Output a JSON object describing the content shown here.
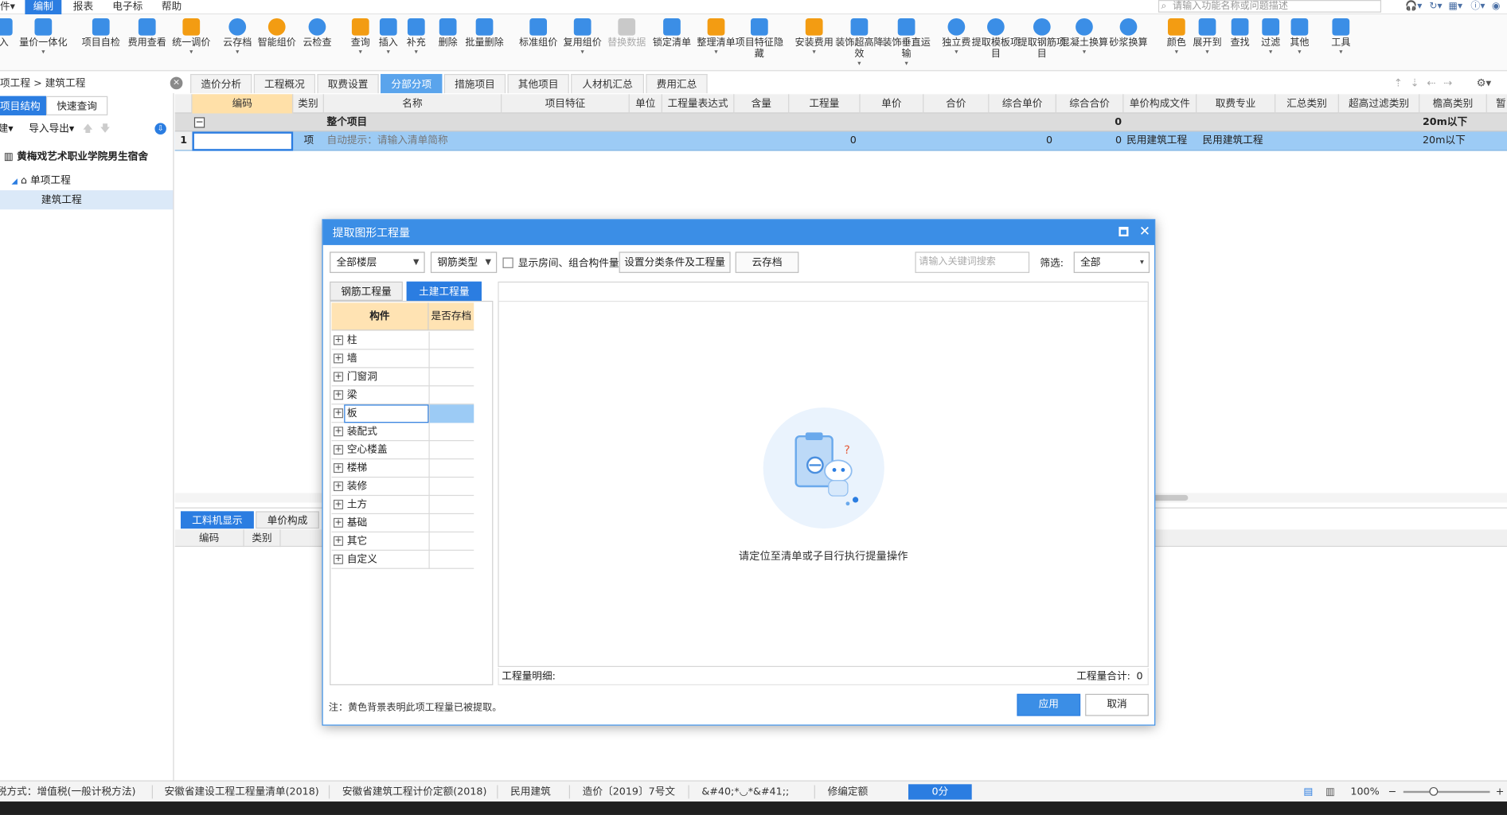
{
  "menubar": {
    "items": [
      "件▾",
      "编制",
      "报表",
      "电子标",
      "帮助"
    ],
    "search_placeholder": "请输入功能名称或问题描述"
  },
  "ribbon": {
    "buttons": [
      {
        "label": "入",
        "dd": ""
      },
      {
        "label": "量价一体化",
        "dd": "▾"
      },
      {
        "label": "项目自检",
        "dd": ""
      },
      {
        "label": "费用查看",
        "dd": ""
      },
      {
        "label": "统一调价",
        "dd": "▾"
      },
      {
        "label": "云存档",
        "dd": "▾"
      },
      {
        "label": "智能组价",
        "dd": ""
      },
      {
        "label": "云检查",
        "dd": ""
      },
      {
        "label": "查询",
        "dd": "▾"
      },
      {
        "label": "插入",
        "dd": "▾"
      },
      {
        "label": "补充",
        "dd": "▾"
      },
      {
        "label": "删除",
        "dd": ""
      },
      {
        "label": "批量删除",
        "dd": ""
      },
      {
        "label": "标准组价",
        "dd": ""
      },
      {
        "label": "复用组价",
        "dd": "▾"
      },
      {
        "label": "替换数据",
        "dd": ""
      },
      {
        "label": "锁定清单",
        "dd": ""
      },
      {
        "label": "整理清单",
        "dd": "▾"
      },
      {
        "label": "项目特征隐藏",
        "dd": ""
      },
      {
        "label": "安装费用",
        "dd": "▾"
      },
      {
        "label": "装饰超高降效",
        "dd": "▾"
      },
      {
        "label": "装饰垂直运输",
        "dd": "▾"
      },
      {
        "label": "独立费",
        "dd": "▾"
      },
      {
        "label": "提取模板项目",
        "dd": ""
      },
      {
        "label": "提取钢筋项目",
        "dd": ""
      },
      {
        "label": "混凝土换算",
        "dd": "▾"
      },
      {
        "label": "砂浆换算",
        "dd": ""
      },
      {
        "label": "颜色",
        "dd": "▾"
      },
      {
        "label": "展开到",
        "dd": "▾"
      },
      {
        "label": "查找",
        "dd": ""
      },
      {
        "label": "过滤",
        "dd": "▾"
      },
      {
        "label": "其他",
        "dd": "▾"
      },
      {
        "label": "工具",
        "dd": "▾"
      }
    ]
  },
  "breadcrumb": "项工程 > 建筑工程",
  "main_tabs": [
    "造价分析",
    "工程概况",
    "取费设置",
    "分部分项",
    "措施项目",
    "其他项目",
    "人材机汇总",
    "费用汇总"
  ],
  "left_panel": {
    "tabs": [
      "项目结构",
      "快速查询"
    ],
    "tools": {
      "new": "建▾",
      "import_export": "导入导出▾"
    },
    "tree": {
      "root": "黄梅戏艺术职业学院男生宿舍",
      "single": "单项工程",
      "unit": "建筑工程"
    }
  },
  "table": {
    "headers": [
      "编码",
      "类别",
      "名称",
      "项目特征",
      "单位",
      "工程量表达式",
      "含量",
      "工程量",
      "单价",
      "合价",
      "综合单价",
      "综合合价",
      "单价构成文件",
      "取费专业",
      "汇总类别",
      "超高过滤类别",
      "檐高类别",
      "暂"
    ],
    "row0": {
      "name": "整个项目",
      "total": "0",
      "eaves": "20m以下"
    },
    "row1": {
      "num": "1",
      "type": "项",
      "name": "自动提示：请输入清单简称",
      "qty": "0",
      "unit_price": "0",
      "total": "0",
      "file": "民用建筑工程",
      "spec": "民用建筑工程",
      "eaves": "20m以下"
    }
  },
  "bottom_panel": {
    "tabs": [
      "工料机显示",
      "单价构成"
    ],
    "headers": [
      "编码",
      "类别"
    ]
  },
  "status_bar": {
    "tax": "计税方式：增值税(一般计税方法)",
    "list": "安徽省建设工程工程量清单(2018)",
    "quota": "安徽省建筑工程计价定额(2018)",
    "type": "民用建筑",
    "doc": "造价〔2019〕7号文",
    "code": "&#40;*◡*&#41;;",
    "repair": "修编定额",
    "score": "0分",
    "zoom": "100%"
  },
  "dialog": {
    "title": "提取图形工程量",
    "floor_select": "全部楼层",
    "rebar_select": "钢筋类型",
    "show_rooms_label": "显示房间、组合构件量",
    "set_conditions_button": "设置分类条件及工程量",
    "cloud_button": "云存档",
    "keyword_placeholder": "请输入关键词搜索",
    "filter_label": "筛选:",
    "filter_value": "全部",
    "tabs": [
      "钢筋工程量",
      "土建工程量"
    ],
    "grid_headers": [
      "构件",
      "是否存档"
    ],
    "components": [
      "柱",
      "墙",
      "门窗洞",
      "梁",
      "板",
      "装配式",
      "空心楼盖",
      "楼梯",
      "装修",
      "土方",
      "基础",
      "其它",
      "自定义"
    ],
    "empty_message": "请定位至清单或子目行执行提量操作",
    "detail_label": "工程量明细:",
    "total_label": "工程量合计:",
    "total_value": "0",
    "note": "注：黄色背景表明此项工程量已被提取。",
    "apply": "应用",
    "cancel": "取消"
  }
}
